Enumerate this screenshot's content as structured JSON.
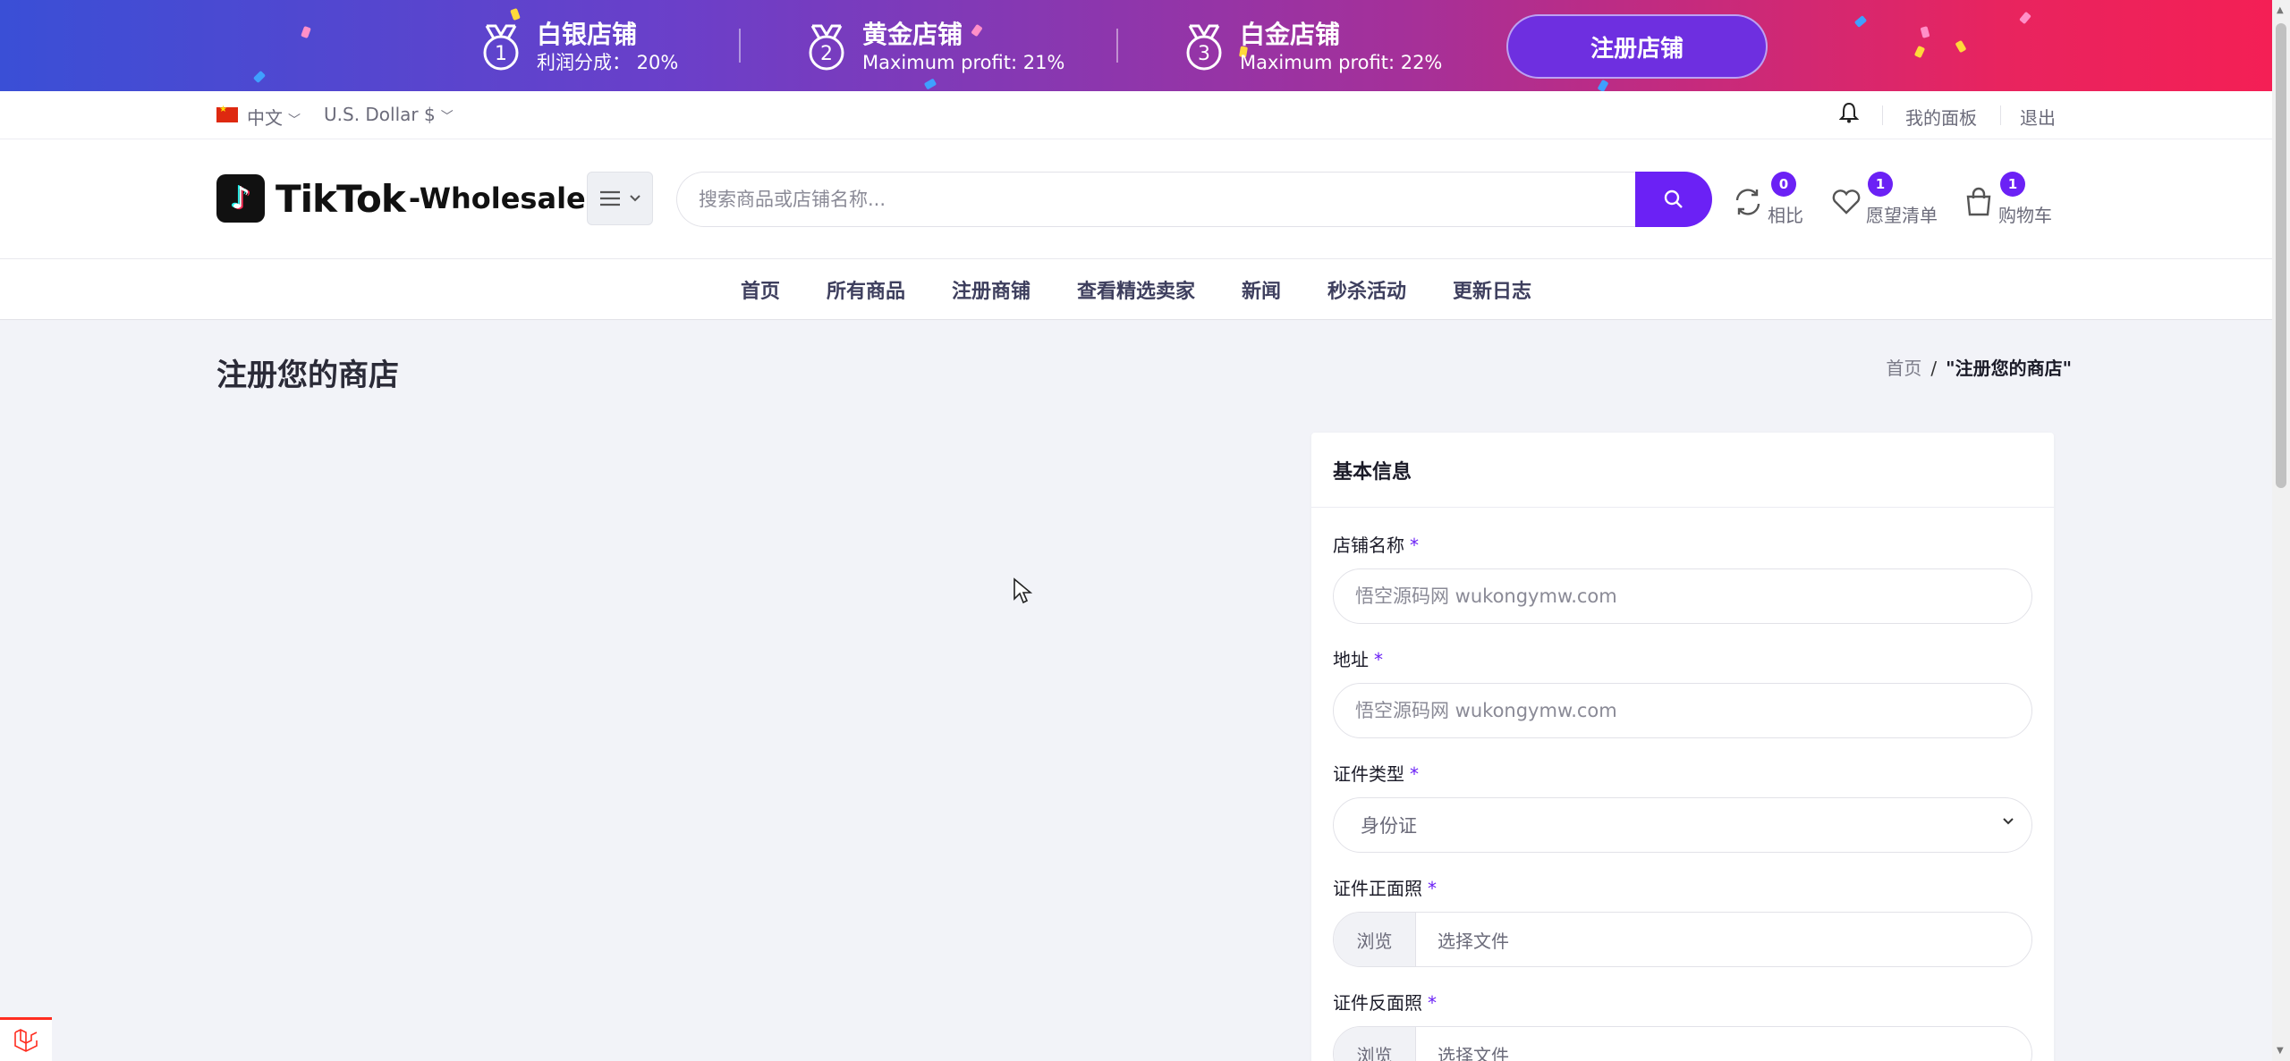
{
  "banner": {
    "tiers": [
      {
        "number": "1",
        "name": "白银店铺",
        "sub": "利润分成：  20%"
      },
      {
        "number": "2",
        "name": "黄金店铺",
        "sub": "Maximum profit: 21%"
      },
      {
        "number": "3",
        "name": "白金店铺",
        "sub": "Maximum profit: 22%"
      }
    ],
    "register_button": "注册店铺"
  },
  "topbar": {
    "language": "中文",
    "currency": "U.S. Dollar $",
    "dashboard": "我的面板",
    "logout": "退出"
  },
  "header": {
    "logo_text": "TikTok",
    "logo_suffix": "-Wholesale",
    "search_placeholder": "搜索商品或店铺名称...",
    "compare": {
      "label": "相比",
      "count": "0"
    },
    "wishlist": {
      "label": "愿望清单",
      "count": "1"
    },
    "cart": {
      "label": "购物车",
      "count": "1"
    }
  },
  "nav": {
    "items": [
      "首页",
      "所有商品",
      "注册商铺",
      "查看精选卖家",
      "新闻",
      "秒杀活动",
      "更新日志"
    ]
  },
  "page": {
    "title": "注册您的商店",
    "breadcrumb": {
      "home": "首页",
      "sep": "/",
      "current": "\"注册您的商店\""
    }
  },
  "form": {
    "card_title": "基本信息",
    "required_mark": "*",
    "shop_name": {
      "label": "店铺名称",
      "placeholder": "悟空源码网 wukongymw.com"
    },
    "address": {
      "label": "地址",
      "placeholder": "悟空源码网 wukongymw.com"
    },
    "id_type": {
      "label": "证件类型",
      "value": "身份证"
    },
    "id_front": {
      "label": "证件正面照",
      "browse": "浏览",
      "file": "选择文件"
    },
    "id_back": {
      "label": "证件反面照",
      "browse": "浏览",
      "file": "选择文件"
    }
  },
  "colors": {
    "accent": "#6b21f5",
    "banner_start": "#3a4fd6",
    "banner_end": "#f41f55",
    "page_bg": "#f2f3f8"
  }
}
